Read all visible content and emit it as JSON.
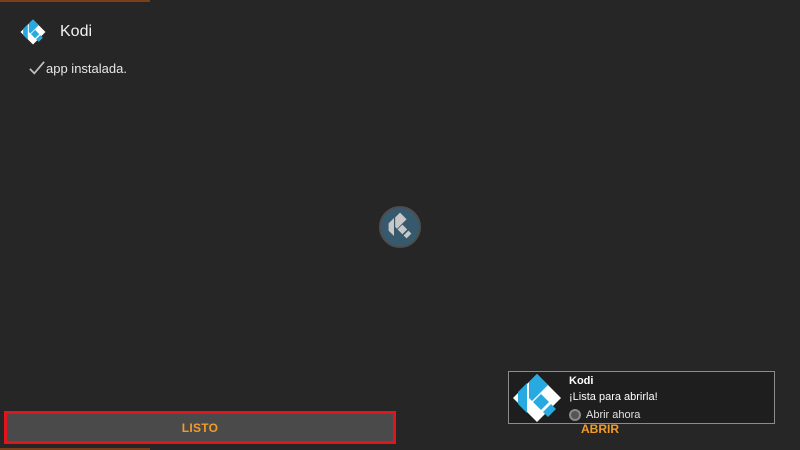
{
  "app": {
    "name": "Kodi",
    "logo_icon": "kodi-logo-icon",
    "status_icon": "checkmark-icon",
    "status_text": "app instalada."
  },
  "center": {
    "icon": "kodi-loading-icon"
  },
  "buttons": {
    "done_label": "LISTO",
    "open_label": "ABRIR"
  },
  "notification": {
    "icon": "kodi-logo-icon",
    "title": "Kodi",
    "message": "¡Lista para abrirla!",
    "action_label": "Abrir ahora"
  },
  "colors": {
    "background": "#262626",
    "accent_orange": "#f29b2b",
    "focus_red": "#e3141b",
    "kodi_blue": "#27a9e1"
  }
}
